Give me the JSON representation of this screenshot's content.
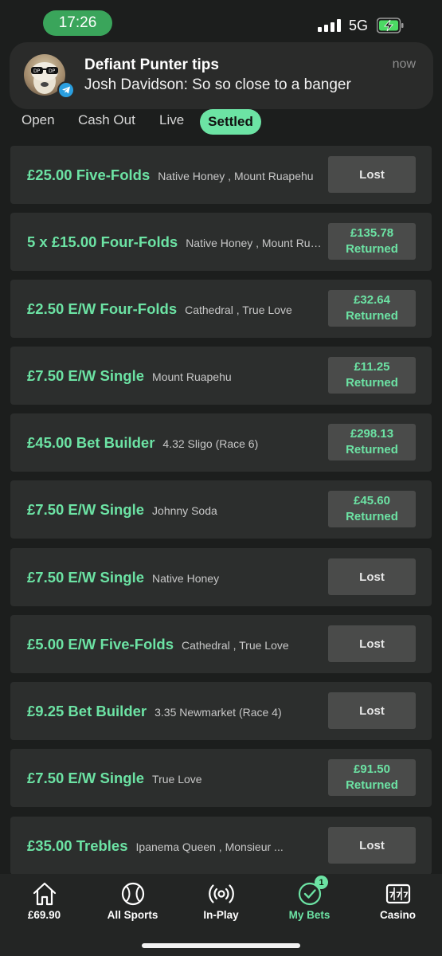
{
  "status_bar": {
    "time": "17:26",
    "network": "5G"
  },
  "notification": {
    "title": "Defiant Punter tips",
    "body": "Josh Davidson: So so close to a banger",
    "time": "now"
  },
  "tabs": [
    {
      "label": "Open"
    },
    {
      "label": "Cash Out"
    },
    {
      "label": "Live"
    },
    {
      "label": "Settled"
    }
  ],
  "bets": [
    {
      "stake": "£25.00 Five-Folds",
      "selection": "Native Honey , Mount Ruapehu",
      "status": "Lost",
      "return_amount": ""
    },
    {
      "stake": "5 x £15.00 Four-Folds",
      "selection": "Native Honey , Mount Ruapehu",
      "status": "Returned",
      "return_amount": "£135.78"
    },
    {
      "stake": "£2.50 E/W Four-Folds",
      "selection": "Cathedral , True Love",
      "status": "Returned",
      "return_amount": "£32.64"
    },
    {
      "stake": "£7.50 E/W Single",
      "selection": "Mount Ruapehu",
      "status": "Returned",
      "return_amount": "£11.25"
    },
    {
      "stake": "£45.00 Bet Builder",
      "selection": "4.32 Sligo (Race 6)",
      "status": "Returned",
      "return_amount": "£298.13"
    },
    {
      "stake": "£7.50 E/W Single",
      "selection": "Johnny Soda",
      "status": "Returned",
      "return_amount": "£45.60"
    },
    {
      "stake": "£7.50 E/W Single",
      "selection": "Native Honey",
      "status": "Lost",
      "return_amount": ""
    },
    {
      "stake": "£5.00 E/W Five-Folds",
      "selection": "Cathedral , True Love",
      "status": "Lost",
      "return_amount": ""
    },
    {
      "stake": "£9.25 Bet Builder",
      "selection": "3.35 Newmarket (Race 4)",
      "status": "Lost",
      "return_amount": ""
    },
    {
      "stake": "£7.50 E/W Single",
      "selection": "True Love",
      "status": "Returned",
      "return_amount": "£91.50"
    },
    {
      "stake": "£35.00 Trebles",
      "selection": "Ipanema Queen , Monsieur ...",
      "status": "Lost",
      "return_amount": ""
    }
  ],
  "bottom_nav": [
    {
      "label": "£69.90",
      "icon": "home-icon"
    },
    {
      "label": "All Sports",
      "icon": "ball-icon"
    },
    {
      "label": "In-Play",
      "icon": "live-signal-icon"
    },
    {
      "label": "My Bets",
      "icon": "check-circle-icon",
      "badge": "1",
      "active": true
    },
    {
      "label": "Casino",
      "icon": "slot-machine-icon"
    }
  ],
  "colors": {
    "accent": "#6ce3a4",
    "background": "#1c1e1d",
    "card": "#2c2e2d",
    "status_button": "#4a4b4a"
  }
}
